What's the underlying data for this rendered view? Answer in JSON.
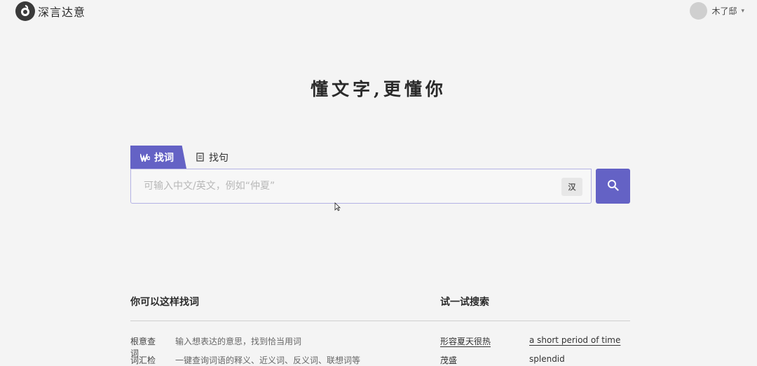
{
  "header": {
    "logo_text": "深言达意",
    "user_name": "木了邸",
    "icons": {
      "logo": "logo-mark-icon",
      "caret": "chevron-down-icon"
    }
  },
  "slogan": "懂文字,更懂你",
  "tabs": [
    {
      "label": "找词",
      "icon": "word-icon",
      "active": true
    },
    {
      "label": "找句",
      "icon": "sentence-icon",
      "active": false
    }
  ],
  "search": {
    "placeholder": "可输入中文/英文，例如“仲夏”",
    "value": "",
    "lang_toggle": "汉",
    "button_icon": "search-icon"
  },
  "guide": {
    "title": "你可以这样找词",
    "items": [
      {
        "label": "根意查词",
        "desc": "输入想表达的意思，找到恰当用词"
      },
      {
        "label": "词汇检索",
        "desc": "一键查询词语的释义、近义词、反义词、联想词等"
      }
    ]
  },
  "try_search": {
    "title": "试一试搜索",
    "items": [
      {
        "text": "形容夏天很热"
      },
      {
        "text": "a short period of time"
      },
      {
        "text": "茂盛"
      },
      {
        "text": "splendid"
      }
    ]
  },
  "colors": {
    "accent": "#6462c5",
    "background": "#f4f4f4"
  }
}
